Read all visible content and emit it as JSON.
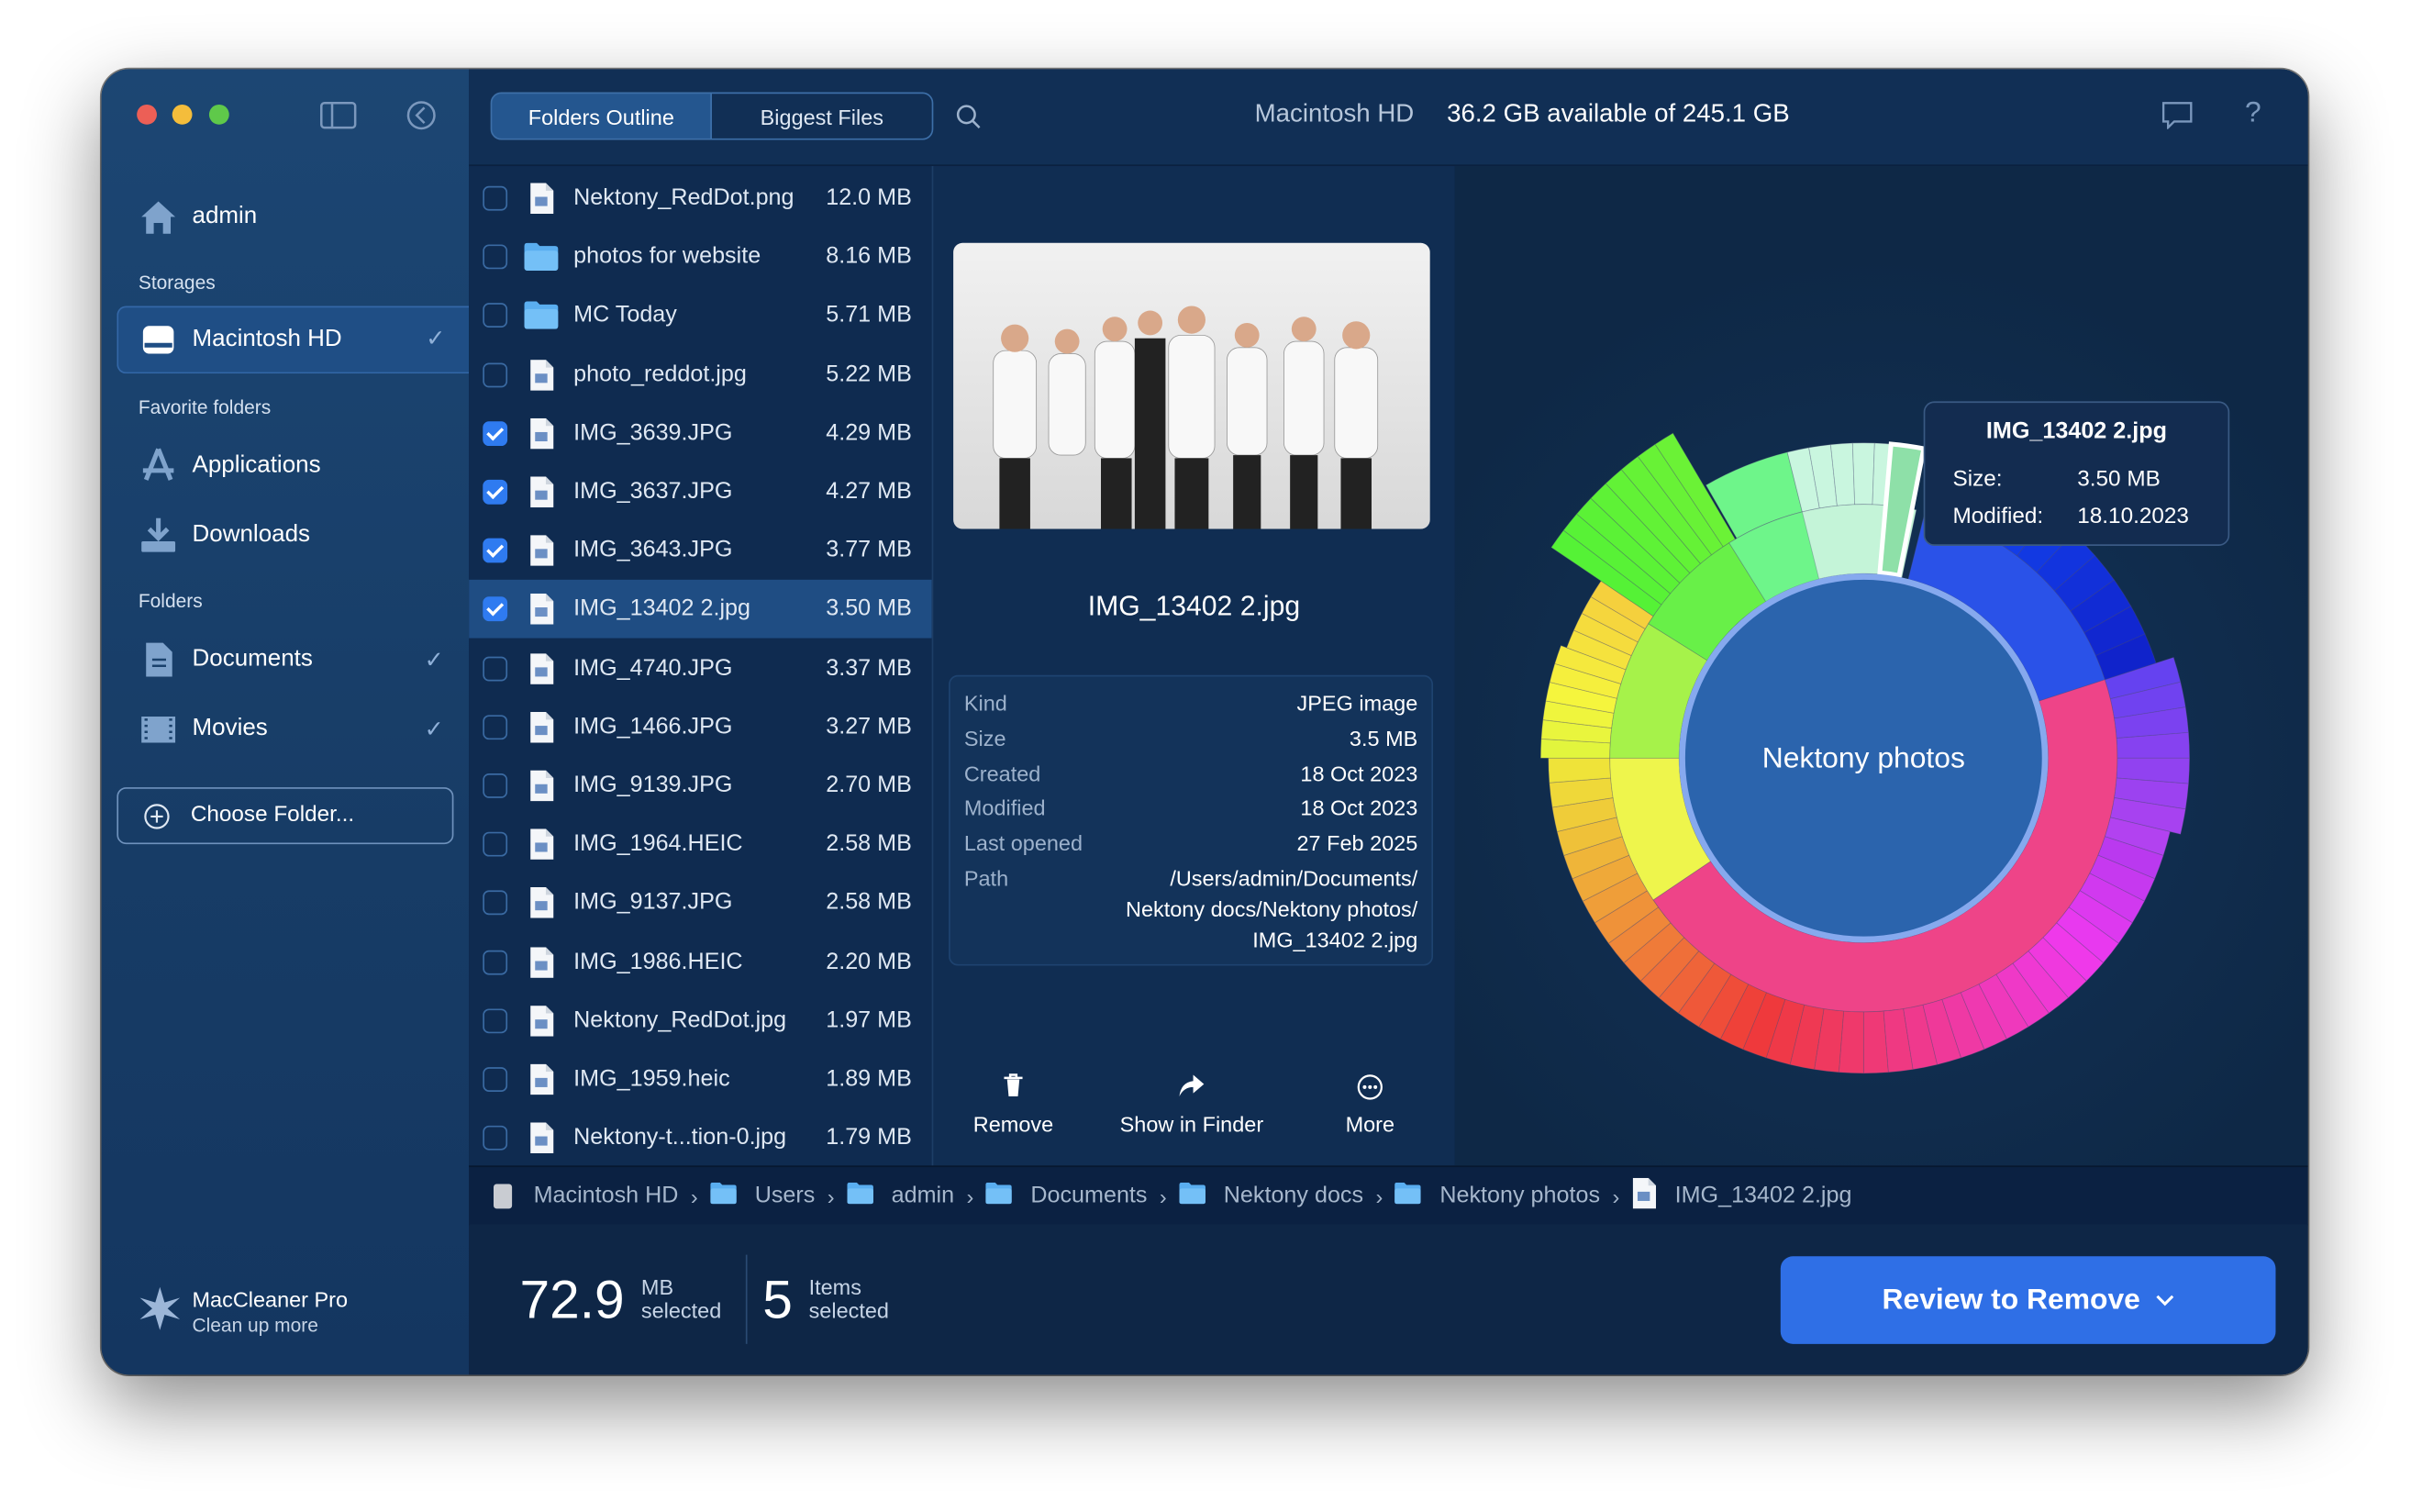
{
  "sidebar": {
    "user": "admin",
    "storages_header": "Storages",
    "storage": "Macintosh HD",
    "favorites_header": "Favorite folders",
    "favorites": [
      {
        "label": "Applications",
        "icon": "applications-icon"
      },
      {
        "label": "Downloads",
        "icon": "downloads-icon"
      }
    ],
    "folders_header": "Folders",
    "folders": [
      {
        "label": "Documents",
        "checked": true
      },
      {
        "label": "Movies",
        "checked": true
      }
    ],
    "choose_folder": "Choose Folder...",
    "app_name": "MacCleaner Pro",
    "app_tagline": "Clean up more"
  },
  "toolbar": {
    "tabs": [
      "Folders Outline",
      "Biggest Files"
    ],
    "active_tab": "Folders Outline",
    "disk_name": "Macintosh HD",
    "disk_info": "36.2 GB available of 245.1 GB"
  },
  "files": [
    {
      "name": "Nektony_RedDot.png",
      "size": "12.0 MB",
      "type": "file",
      "checked": false
    },
    {
      "name": "photos for website",
      "size": "8.16 MB",
      "type": "folder",
      "checked": false
    },
    {
      "name": "MC Today",
      "size": "5.71 MB",
      "type": "folder",
      "checked": false
    },
    {
      "name": "photo_reddot.jpg",
      "size": "5.22 MB",
      "type": "file",
      "checked": false
    },
    {
      "name": "IMG_3639.JPG",
      "size": "4.29 MB",
      "type": "file",
      "checked": true
    },
    {
      "name": "IMG_3637.JPG",
      "size": "4.27 MB",
      "type": "file",
      "checked": true
    },
    {
      "name": "IMG_3643.JPG",
      "size": "3.77 MB",
      "type": "file",
      "checked": true
    },
    {
      "name": "IMG_13402 2.jpg",
      "size": "3.50 MB",
      "type": "file",
      "checked": true,
      "selected": true
    },
    {
      "name": "IMG_4740.JPG",
      "size": "3.37 MB",
      "type": "file",
      "checked": false
    },
    {
      "name": "IMG_1466.JPG",
      "size": "3.27 MB",
      "type": "file",
      "checked": false
    },
    {
      "name": "IMG_9139.JPG",
      "size": "2.70 MB",
      "type": "file",
      "checked": false
    },
    {
      "name": "IMG_1964.HEIC",
      "size": "2.58 MB",
      "type": "file",
      "checked": false
    },
    {
      "name": "IMG_9137.JPG",
      "size": "2.58 MB",
      "type": "file",
      "checked": false
    },
    {
      "name": "IMG_1986.HEIC",
      "size": "2.20 MB",
      "type": "file",
      "checked": false
    },
    {
      "name": "Nektony_RedDot.jpg",
      "size": "1.97 MB",
      "type": "file",
      "checked": false
    },
    {
      "name": "IMG_1959.heic",
      "size": "1.89 MB",
      "type": "file",
      "checked": false
    },
    {
      "name": "Nektony-t...tion-0.jpg",
      "size": "1.79 MB",
      "type": "file",
      "checked": false
    }
  ],
  "preview": {
    "title": "IMG_13402 2.jpg",
    "details": [
      {
        "k": "Kind",
        "v": "JPEG image"
      },
      {
        "k": "Size",
        "v": "3.5 MB"
      },
      {
        "k": "Created",
        "v": "18 Oct 2023"
      },
      {
        "k": "Modified",
        "v": "18 Oct 2023"
      },
      {
        "k": "Last opened",
        "v": "27 Feb 2025"
      },
      {
        "k": "Path",
        "v": "/Users/admin/Documents/"
      },
      {
        "k": "",
        "v": "Nektony docs/Nektony photos/"
      },
      {
        "k": "",
        "v": "IMG_13402 2.jpg"
      }
    ],
    "actions": [
      {
        "label": "Remove",
        "icon": "trash-icon"
      },
      {
        "label": "Show in Finder",
        "icon": "share-arrow-icon"
      },
      {
        "label": "More",
        "icon": "more-icon"
      }
    ]
  },
  "sunburst": {
    "center_label": "Nektony photos",
    "tooltip": {
      "title": "IMG_13402 2.jpg",
      "size_label": "Size:",
      "size": "3.50 MB",
      "modified_label": "Modified:",
      "modified": "18.10.2023"
    },
    "inner_ring": [
      {
        "from": -32,
        "to": 12,
        "color": "#c4f4d8"
      },
      {
        "from": 14,
        "to": 72,
        "color": "#2a52e8"
      },
      {
        "from": 72,
        "to": 236,
        "color": "#ee4488"
      },
      {
        "from": 236,
        "to": 270,
        "color": "#eef54c"
      },
      {
        "from": 270,
        "to": 302,
        "color": "#a6f24a"
      },
      {
        "from": 302,
        "to": 328,
        "color": "#68f048"
      },
      {
        "from": 328,
        "to": 346,
        "color": "#6ef58a"
      }
    ],
    "highlight_angle": 8
  },
  "breadcrumb": [
    "Macintosh HD",
    "Users",
    "admin",
    "Documents",
    "Nektony docs",
    "Nektony photos",
    "IMG_13402 2.jpg"
  ],
  "footer": {
    "size_value": "72.9",
    "size_unit": "MB",
    "size_caption": "selected",
    "items_value": "5",
    "items_unit": "Items",
    "items_caption": "selected",
    "review_button": "Review to Remove"
  },
  "colors": {
    "accent": "#2f7bf0",
    "button": "#2f6fe6",
    "sidebar": "#1c4673",
    "main": "#0f2a4c"
  }
}
